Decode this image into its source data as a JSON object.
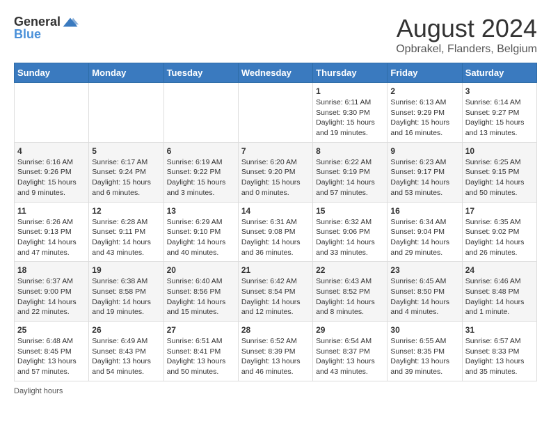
{
  "header": {
    "logo_general": "General",
    "logo_blue": "Blue",
    "month_year": "August 2024",
    "location": "Opbrakel, Flanders, Belgium"
  },
  "days_of_week": [
    "Sunday",
    "Monday",
    "Tuesday",
    "Wednesday",
    "Thursday",
    "Friday",
    "Saturday"
  ],
  "weeks": [
    [
      {
        "day": "",
        "content": ""
      },
      {
        "day": "",
        "content": ""
      },
      {
        "day": "",
        "content": ""
      },
      {
        "day": "",
        "content": ""
      },
      {
        "day": "1",
        "content": "Sunrise: 6:11 AM\nSunset: 9:30 PM\nDaylight: 15 hours\nand 19 minutes."
      },
      {
        "day": "2",
        "content": "Sunrise: 6:13 AM\nSunset: 9:29 PM\nDaylight: 15 hours\nand 16 minutes."
      },
      {
        "day": "3",
        "content": "Sunrise: 6:14 AM\nSunset: 9:27 PM\nDaylight: 15 hours\nand 13 minutes."
      }
    ],
    [
      {
        "day": "4",
        "content": "Sunrise: 6:16 AM\nSunset: 9:26 PM\nDaylight: 15 hours\nand 9 minutes."
      },
      {
        "day": "5",
        "content": "Sunrise: 6:17 AM\nSunset: 9:24 PM\nDaylight: 15 hours\nand 6 minutes."
      },
      {
        "day": "6",
        "content": "Sunrise: 6:19 AM\nSunset: 9:22 PM\nDaylight: 15 hours\nand 3 minutes."
      },
      {
        "day": "7",
        "content": "Sunrise: 6:20 AM\nSunset: 9:20 PM\nDaylight: 15 hours\nand 0 minutes."
      },
      {
        "day": "8",
        "content": "Sunrise: 6:22 AM\nSunset: 9:19 PM\nDaylight: 14 hours\nand 57 minutes."
      },
      {
        "day": "9",
        "content": "Sunrise: 6:23 AM\nSunset: 9:17 PM\nDaylight: 14 hours\nand 53 minutes."
      },
      {
        "day": "10",
        "content": "Sunrise: 6:25 AM\nSunset: 9:15 PM\nDaylight: 14 hours\nand 50 minutes."
      }
    ],
    [
      {
        "day": "11",
        "content": "Sunrise: 6:26 AM\nSunset: 9:13 PM\nDaylight: 14 hours\nand 47 minutes."
      },
      {
        "day": "12",
        "content": "Sunrise: 6:28 AM\nSunset: 9:11 PM\nDaylight: 14 hours\nand 43 minutes."
      },
      {
        "day": "13",
        "content": "Sunrise: 6:29 AM\nSunset: 9:10 PM\nDaylight: 14 hours\nand 40 minutes."
      },
      {
        "day": "14",
        "content": "Sunrise: 6:31 AM\nSunset: 9:08 PM\nDaylight: 14 hours\nand 36 minutes."
      },
      {
        "day": "15",
        "content": "Sunrise: 6:32 AM\nSunset: 9:06 PM\nDaylight: 14 hours\nand 33 minutes."
      },
      {
        "day": "16",
        "content": "Sunrise: 6:34 AM\nSunset: 9:04 PM\nDaylight: 14 hours\nand 29 minutes."
      },
      {
        "day": "17",
        "content": "Sunrise: 6:35 AM\nSunset: 9:02 PM\nDaylight: 14 hours\nand 26 minutes."
      }
    ],
    [
      {
        "day": "18",
        "content": "Sunrise: 6:37 AM\nSunset: 9:00 PM\nDaylight: 14 hours\nand 22 minutes."
      },
      {
        "day": "19",
        "content": "Sunrise: 6:38 AM\nSunset: 8:58 PM\nDaylight: 14 hours\nand 19 minutes."
      },
      {
        "day": "20",
        "content": "Sunrise: 6:40 AM\nSunset: 8:56 PM\nDaylight: 14 hours\nand 15 minutes."
      },
      {
        "day": "21",
        "content": "Sunrise: 6:42 AM\nSunset: 8:54 PM\nDaylight: 14 hours\nand 12 minutes."
      },
      {
        "day": "22",
        "content": "Sunrise: 6:43 AM\nSunset: 8:52 PM\nDaylight: 14 hours\nand 8 minutes."
      },
      {
        "day": "23",
        "content": "Sunrise: 6:45 AM\nSunset: 8:50 PM\nDaylight: 14 hours\nand 4 minutes."
      },
      {
        "day": "24",
        "content": "Sunrise: 6:46 AM\nSunset: 8:48 PM\nDaylight: 14 hours\nand 1 minute."
      }
    ],
    [
      {
        "day": "25",
        "content": "Sunrise: 6:48 AM\nSunset: 8:45 PM\nDaylight: 13 hours\nand 57 minutes."
      },
      {
        "day": "26",
        "content": "Sunrise: 6:49 AM\nSunset: 8:43 PM\nDaylight: 13 hours\nand 54 minutes."
      },
      {
        "day": "27",
        "content": "Sunrise: 6:51 AM\nSunset: 8:41 PM\nDaylight: 13 hours\nand 50 minutes."
      },
      {
        "day": "28",
        "content": "Sunrise: 6:52 AM\nSunset: 8:39 PM\nDaylight: 13 hours\nand 46 minutes."
      },
      {
        "day": "29",
        "content": "Sunrise: 6:54 AM\nSunset: 8:37 PM\nDaylight: 13 hours\nand 43 minutes."
      },
      {
        "day": "30",
        "content": "Sunrise: 6:55 AM\nSunset: 8:35 PM\nDaylight: 13 hours\nand 39 minutes."
      },
      {
        "day": "31",
        "content": "Sunrise: 6:57 AM\nSunset: 8:33 PM\nDaylight: 13 hours\nand 35 minutes."
      }
    ]
  ],
  "footer": {
    "note": "Daylight hours"
  }
}
